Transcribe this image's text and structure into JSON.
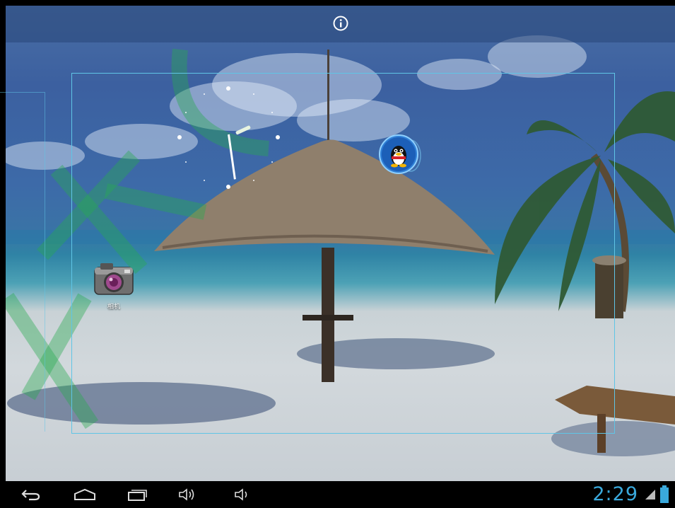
{
  "status_bar": {
    "time": "2:29"
  },
  "info_button": {
    "icon": "info-icon"
  },
  "home_screen": {
    "apps": [
      {
        "id": "camera",
        "label": "相机",
        "icon": "camera-icon"
      },
      {
        "id": "qq",
        "label": "",
        "icon": "qq-penguin-icon"
      }
    ],
    "widgets": [
      {
        "type": "analog-clock"
      }
    ]
  },
  "nav_bar": {
    "buttons": [
      {
        "name": "back-button",
        "icon": "back-icon"
      },
      {
        "name": "home-button",
        "icon": "home-icon"
      },
      {
        "name": "recent-apps-button",
        "icon": "recent-apps-icon"
      },
      {
        "name": "volume-up-button",
        "icon": "volume-up-icon"
      },
      {
        "name": "volume-down-button",
        "icon": "volume-down-icon"
      }
    ],
    "accent_color": "#3aa9dc"
  },
  "colors": {
    "frame": "#5fc5e6",
    "sky": "#3c60a0",
    "sand": "#d2d8dc"
  }
}
